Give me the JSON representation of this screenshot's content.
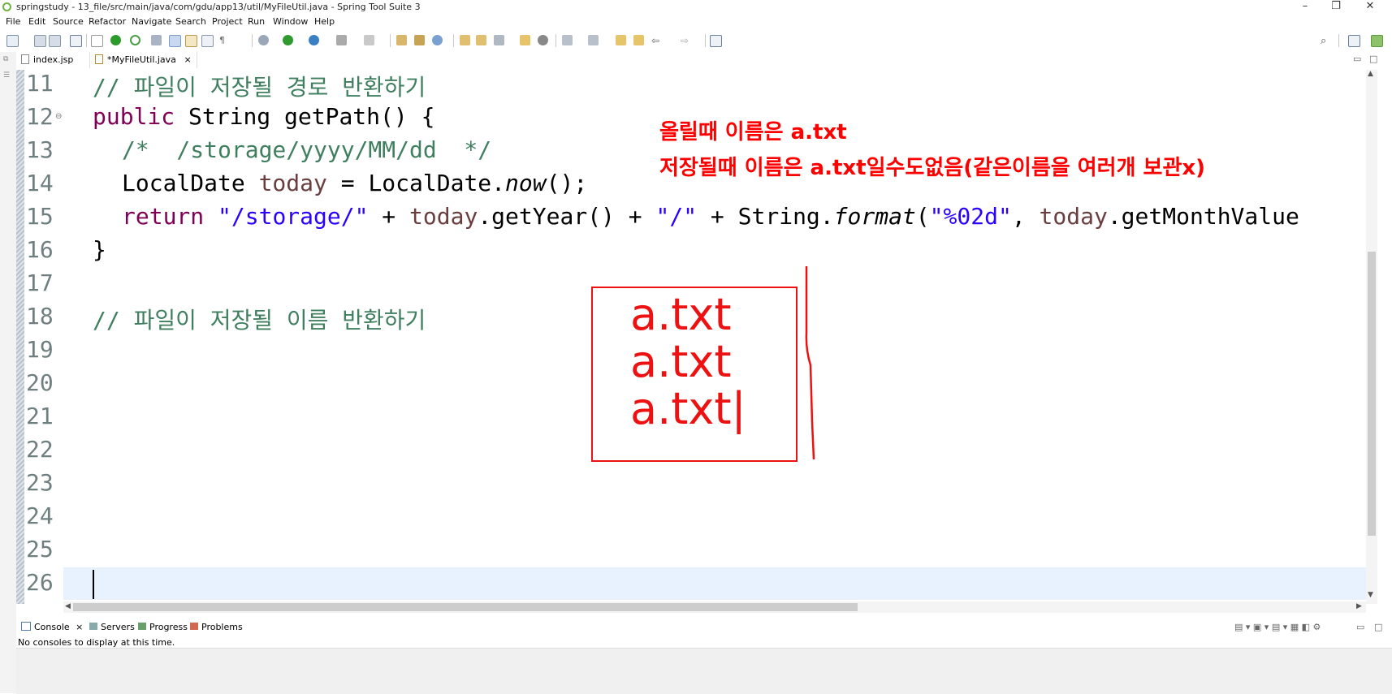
{
  "window": {
    "title": "springstudy - 13_file/src/main/java/com/gdu/app13/util/MyFileUtil.java - Spring Tool Suite 3",
    "minimize": "–",
    "restore": "❐",
    "close": "✕"
  },
  "menu": [
    "File",
    "Edit",
    "Source",
    "Refactor",
    "Navigate",
    "Search",
    "Project",
    "Run",
    "Window",
    "Help"
  ],
  "tabs": [
    {
      "label": "index.jsp"
    },
    {
      "label": "*MyFileUtil.java",
      "close": "×"
    }
  ],
  "editor": {
    "lines": [
      {
        "n": "11"
      },
      {
        "n": "12"
      },
      {
        "n": "13"
      },
      {
        "n": "14"
      },
      {
        "n": "15"
      },
      {
        "n": "16"
      },
      {
        "n": "17"
      },
      {
        "n": "18"
      },
      {
        "n": "19"
      },
      {
        "n": "20"
      },
      {
        "n": "21"
      },
      {
        "n": "22"
      },
      {
        "n": "23"
      },
      {
        "n": "24"
      },
      {
        "n": "25"
      },
      {
        "n": "26"
      }
    ],
    "code": {
      "l11_comment": "// 파일이 저장될 경로 반환하기",
      "l12_kw": "public",
      "l12_rest": " String getPath() {",
      "l13_comment": "/*  /storage/yyyy/MM/dd  */",
      "l14_a": "LocalDate ",
      "l14_field": "today",
      "l14_b": " = LocalDate.",
      "l14_method": "now",
      "l14_c": "();",
      "l15_kw": "return",
      "l15_str1": "\"/storage/\"",
      "l15_a": " + ",
      "l15_field1": "today",
      "l15_b": ".getYear() + ",
      "l15_str2": "\"/\"",
      "l15_c": " + String.",
      "l15_method": "format",
      "l15_d": "(",
      "l15_str3": "\"%02d\"",
      "l15_e": ", ",
      "l15_field2": "today",
      "l15_f": ".getMonthValue",
      "l16": "}",
      "l18_comment": "// 파일이 저장될 이름 반환하기"
    }
  },
  "annotations": {
    "note1": "올릴때 이름은 a.txt",
    "note2": "저장될때 이름은 a.txt일수도없음(같은이름을 여러개 보관x)",
    "box_lines": [
      "a.txt",
      "a.txt",
      "a.txt|"
    ],
    "color": "#ff0000"
  },
  "console": {
    "tabs": [
      "Console",
      "Servers",
      "Progress",
      "Problems"
    ],
    "message": "No consoles to display at this time."
  }
}
